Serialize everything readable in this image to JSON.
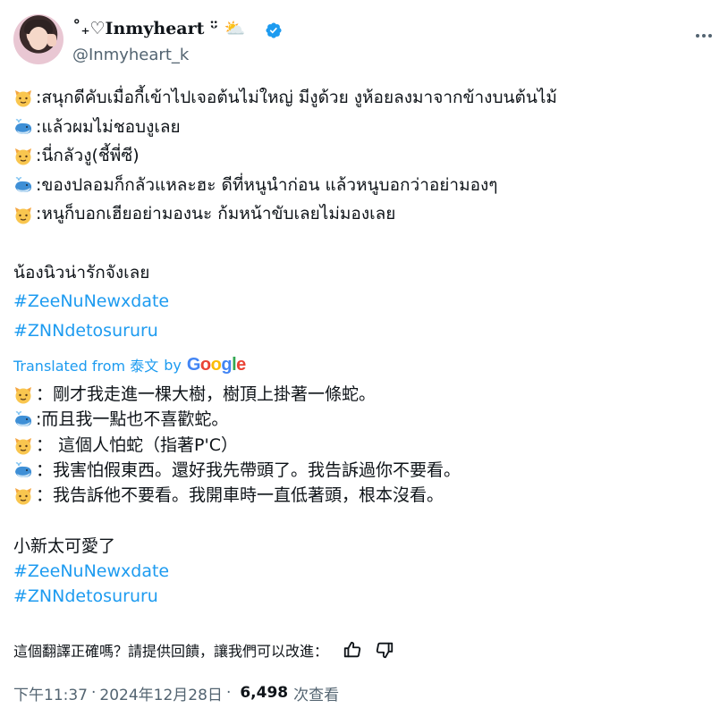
{
  "author": {
    "display_name": "˚₊♡Inmyheart ᵕ̈  ⛅",
    "handle": "@Inmyheart_k",
    "verified_color": "#1d9bf0"
  },
  "tweet": {
    "lines": [
      {
        "icon": "cat-emoji",
        "text": ":สนุกดีคับเมื่อกี้เข้าไปเจอต้นไม่ใหญ่ มีงูด้วย งูห้อยลงมาจากข้างบนต้นไม้"
      },
      {
        "icon": "whale-emoji",
        "text": ":แล้วผมไม่ชอบงูเลย"
      },
      {
        "icon": "cat-emoji",
        "text": ":นี่กลัวงู(ชี้พี่ซี)"
      },
      {
        "icon": "whale-emoji",
        "text": ":ของปลอมก็กลัวแหละฮะ ดีที่หนูนำก่อน แล้วหนูบอกว่าอย่ามองๆ"
      },
      {
        "icon": "cat-emoji",
        "text": ":หนูก็บอกเฮียอย่ามองนะ ก้มหน้าขับเลยไม่มองเลย"
      }
    ],
    "closing": "น้องนิวน่ารักจังเลย",
    "hashtags": [
      "#ZeeNuNewxdate",
      "#ZNNdetosururu"
    ]
  },
  "translation": {
    "label": "Translated from 泰文",
    "by": "by",
    "provider": "Google",
    "lines": [
      {
        "icon": "cat-emoji",
        "text": "：剛才我走進一棵大樹，樹頂上掛著一條蛇。"
      },
      {
        "icon": "whale-emoji",
        "text": ":而且我一點也不喜歡蛇。"
      },
      {
        "icon": "cat-emoji",
        "text": "： 這個人怕蛇（指著P'C）"
      },
      {
        "icon": "whale-emoji",
        "text": "：我害怕假東西。還好我先帶頭了。我告訴過你不要看。"
      },
      {
        "icon": "cat-emoji",
        "text": "：我告訴他不要看。我開車時一直低著頭，根本沒看。"
      }
    ],
    "closing": "小新太可愛了",
    "hashtags": [
      "#ZeeNuNewxdate",
      "#ZNNdetosururu"
    ]
  },
  "feedback": {
    "prompt": "這個翻譯正確嗎？請提供回饋，讓我們可以改進："
  },
  "meta": {
    "time": "下午11:37",
    "separator": "·",
    "date": "2024年12月28日",
    "views": "6,498",
    "views_label": "次查看"
  },
  "colors": {
    "accent": "#1d9bf0",
    "text": "#0f1419",
    "muted": "#536471"
  }
}
